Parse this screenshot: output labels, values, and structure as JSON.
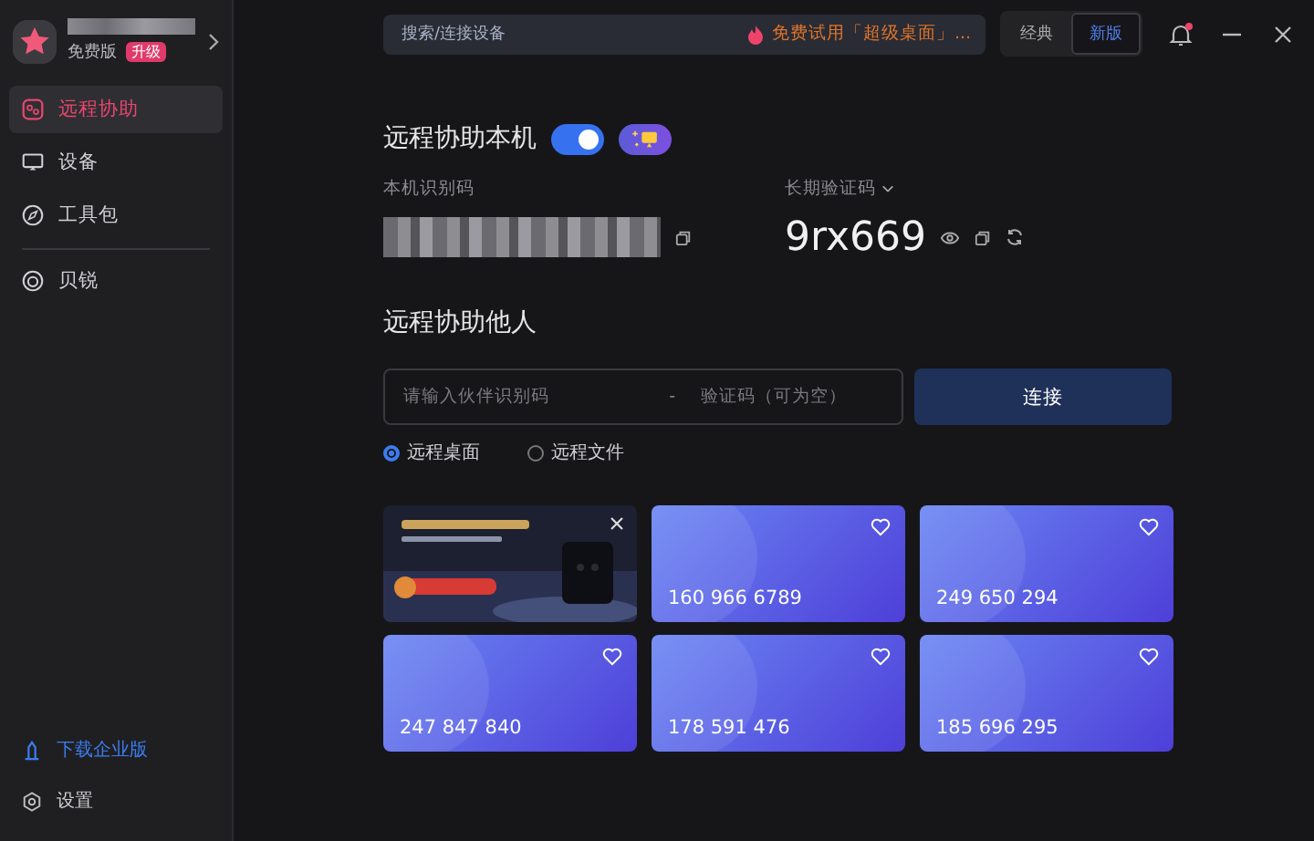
{
  "account": {
    "plan": "免费版",
    "upgrade": "升级"
  },
  "sidebar": {
    "items": [
      {
        "label": "远程协助",
        "selected": true
      },
      {
        "label": "设备",
        "selected": false
      },
      {
        "label": "工具包",
        "selected": false
      },
      {
        "label": "贝锐",
        "selected": false
      }
    ],
    "download": "下载企业版",
    "settings": "设置"
  },
  "topbar": {
    "search": {
      "placeholder": "搜索/连接设备"
    },
    "promo": "免费试用「超级桌面」...",
    "modes": [
      {
        "label": "经典",
        "selected": false
      },
      {
        "label": "新版",
        "selected": true
      }
    ],
    "notification_unread": true
  },
  "host": {
    "title": "远程协助本机",
    "enabled": true,
    "id_label": "本机识别码",
    "code_label": "长期验证码",
    "code": "9rx669"
  },
  "connect": {
    "title": "远程协助他人",
    "partner_placeholder": "请输入伙伴识别码",
    "separator": "-",
    "code_placeholder": "验证码（可为空）",
    "button": "连接",
    "options": [
      {
        "label": "远程桌面",
        "selected": true
      },
      {
        "label": "远程文件",
        "selected": false
      }
    ]
  },
  "devices": [
    {
      "kind": "picture"
    },
    {
      "kind": "device",
      "number": "160 966 6789"
    },
    {
      "kind": "device",
      "number": "249 650 294"
    },
    {
      "kind": "device",
      "number": "247 847 840"
    },
    {
      "kind": "device",
      "number": "178 591 476"
    },
    {
      "kind": "device",
      "number": "185 696 295"
    }
  ]
}
